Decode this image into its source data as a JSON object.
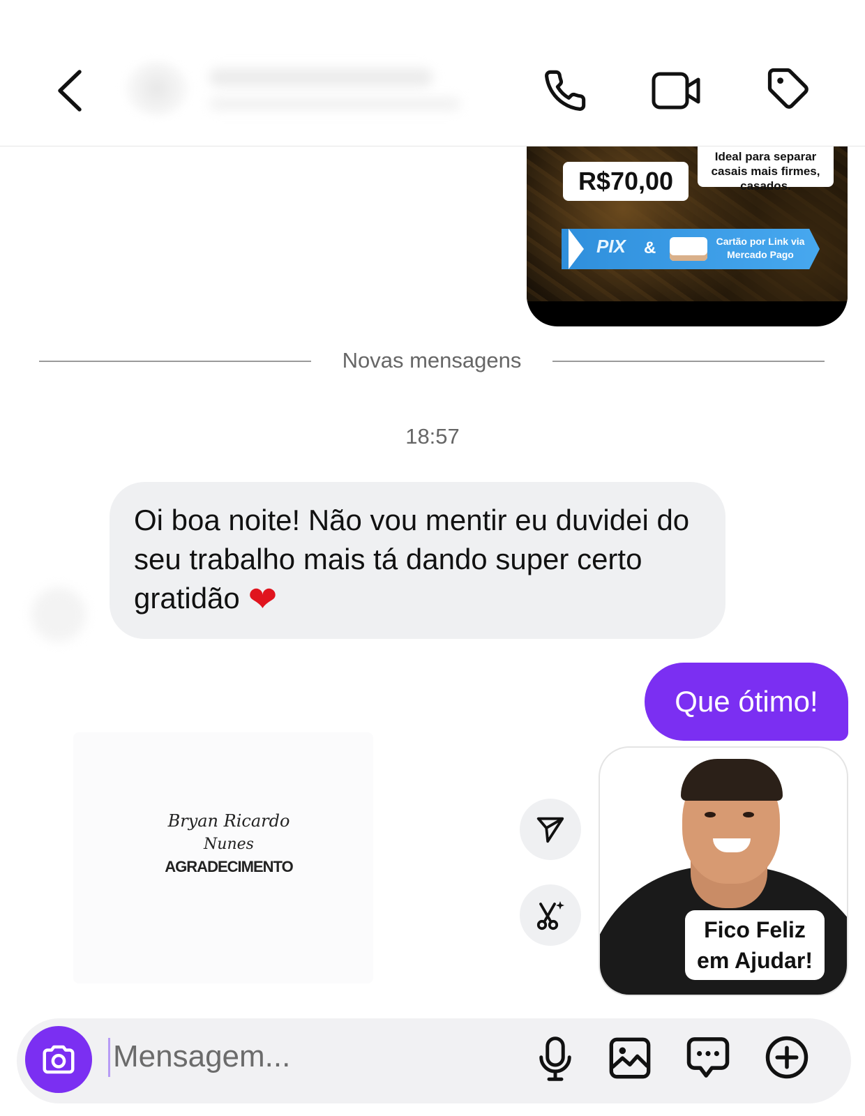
{
  "header": {
    "back_icon": "chevron-left-icon",
    "call_icon": "phone-icon",
    "video_icon": "video-camera-icon",
    "tag_icon": "tag-icon"
  },
  "media_card": {
    "price": "R$70,00",
    "ideal_text": "Ideal para separar casais mais firmes, casados.",
    "pix_label": "PIX",
    "ampersand": "&",
    "card_text": "Cartão por Link via Mercado Pago"
  },
  "divider": {
    "label": "Novas mensagens"
  },
  "thread": {
    "timestamp": "18:57",
    "incoming_text": "Oi boa noite! Não vou mentir eu duvidei do seu trabalho mais tá dando super certo gratidão",
    "heart": "❤",
    "outgoing_text": "Que ótimo!"
  },
  "attachment": {
    "signature_line1": "Bryan Ricardo",
    "signature_line2": "Nunes",
    "signature_line3": "AGRADECIMENTO"
  },
  "sticker": {
    "caption_line1": "Fico Feliz",
    "caption_line2": "em Ajudar!"
  },
  "composer": {
    "placeholder": "Mensagem...",
    "value": ""
  },
  "colors": {
    "accent": "#7b2ff2",
    "bubble_incoming": "#eff0f2",
    "heart": "#e0141e"
  }
}
